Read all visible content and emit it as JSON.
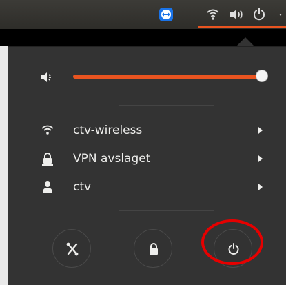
{
  "topbar": {
    "icons": [
      "teamviewer-icon",
      "wifi-icon",
      "speaker-icon",
      "power-icon",
      "menu-arrow-icon"
    ]
  },
  "volume": {
    "icon": "speaker-muted-icon",
    "level": 1.0,
    "accent_color": "#e95420"
  },
  "menu": {
    "items": [
      {
        "icon": "wifi-icon",
        "label": "ctv-wireless"
      },
      {
        "icon": "vpn-lock-icon",
        "label": "VPN avslaget"
      },
      {
        "icon": "user-icon",
        "label": "ctv"
      }
    ]
  },
  "actions": [
    {
      "name": "settings-button",
      "icon": "settings-icon"
    },
    {
      "name": "lock-button",
      "icon": "lock-icon"
    },
    {
      "name": "power-off-button",
      "icon": "power-icon"
    }
  ],
  "annotation": {
    "highlight_color": "#e60000"
  }
}
